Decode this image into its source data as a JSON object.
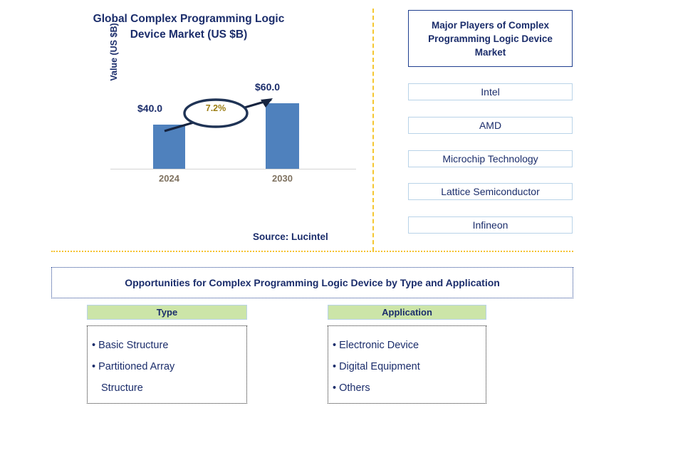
{
  "chart_data": {
    "type": "bar",
    "title": "Global Complex Programming Logic Device Market (US $B)",
    "title_line_1": "Global Complex Programming Logic",
    "title_line_2": "Device Market (US $B)",
    "categories": [
      "2024",
      "2030"
    ],
    "values": [
      40.0,
      60.0
    ],
    "value_labels": [
      "$40.0",
      "$60.0"
    ],
    "xlabel": "",
    "ylabel": "Value (US $B)",
    "ylim": [
      0,
      70
    ],
    "grid": false,
    "legend": "none",
    "annotation": "7.2%",
    "annotation_kind": "cagr-ellipse-with-arrow",
    "bar_color": "#4f81bd",
    "source": "Source: Lucintel"
  },
  "chart_panel": {
    "title_line_1": "Global Complex Programming Logic",
    "title_line_2": "Device Market (US $B)",
    "y_axis_label": "Value (US $B)",
    "bar_2024_label": "$40.0",
    "bar_2030_label": "$60.0",
    "tick_2024": "2024",
    "tick_2030": "2030",
    "cagr": "7.2%",
    "source": "Source: Lucintel"
  },
  "players_panel": {
    "header": "Major Players of Complex Programming Logic Device Market",
    "items": [
      {
        "label": "Intel"
      },
      {
        "label": "AMD"
      },
      {
        "label": "Microchip Technology"
      },
      {
        "label": "Lattice Semiconductor"
      },
      {
        "label": "Infineon"
      }
    ]
  },
  "opportunities": {
    "title": "Opportunities for Complex Programming Logic Device by Type and Application",
    "columns": [
      {
        "header": "Type",
        "items": [
          "Basic Structure",
          "Partitioned Array Structure"
        ],
        "lines": [
          {
            "bullet": "•",
            "text": "Basic Structure",
            "continuation": false
          },
          {
            "bullet": "•",
            "text": "Partitioned Array",
            "continuation": false
          },
          {
            "bullet": "",
            "text": "Structure",
            "continuation": true
          }
        ]
      },
      {
        "header": "Application",
        "items": [
          "Electronic Device",
          "Digital Equipment",
          "Others"
        ],
        "lines": [
          {
            "bullet": "•",
            "text": "Electronic Device",
            "continuation": false
          },
          {
            "bullet": "•",
            "text": "Digital Equipment",
            "continuation": false
          },
          {
            "bullet": "•",
            "text": "Others",
            "continuation": false
          }
        ]
      }
    ]
  },
  "colors": {
    "bar": "#4f81bd",
    "navy_text": "#1b2d6b",
    "divider_gold": "#f5b80a",
    "header_green": "#cce5a8",
    "player_border": "#b9d3e8",
    "tick_brown": "#7f7260",
    "cagr_gold": "#9b7d12"
  }
}
